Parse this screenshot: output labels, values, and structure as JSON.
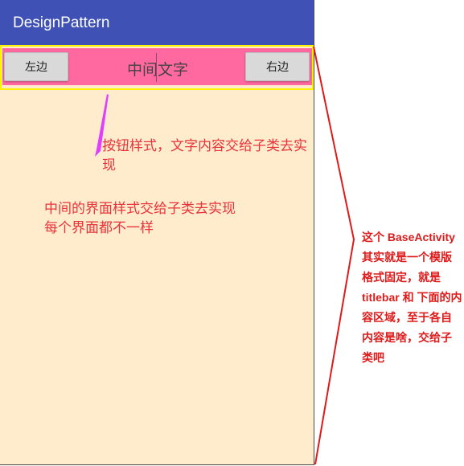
{
  "app": {
    "title": "DesignPattern"
  },
  "titlebar": {
    "left_button": "左边",
    "center_text": "中间文字",
    "right_button": "右边"
  },
  "annotations": {
    "button_note": "按钮样式，文字内容交给子类去实现",
    "content_note_line1": "中间的界面样式交给子类去实现",
    "content_note_line2": "每个界面都不一样",
    "side_note": "这个 BaseActivity 其实就是一个模版格式固定，就是 titlebar 和 下面的内容区域，至于各自内容是啥，交给子类吧"
  },
  "colors": {
    "appbar": "#3f51b5",
    "titlebar": "#ff69a0",
    "titlebar_outline": "#fff200",
    "content_bg": "#feeccd",
    "annotation": "#e8333a",
    "arrow": "#e040fb"
  }
}
